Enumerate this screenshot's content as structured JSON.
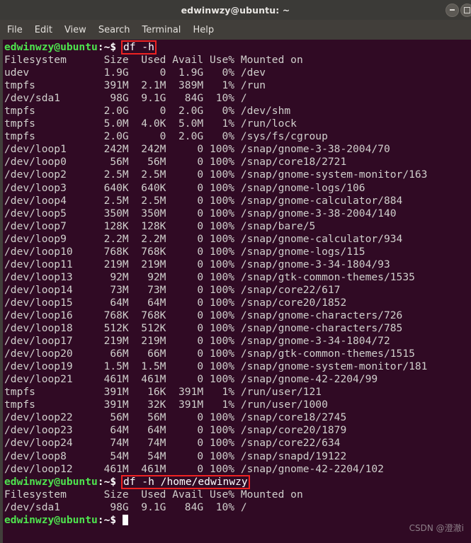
{
  "titlebar": {
    "title": "edwinwzy@ubuntu: ~",
    "minimize_label": "",
    "maximize_label": ""
  },
  "menubar": {
    "items": [
      {
        "label": "File"
      },
      {
        "label": "Edit"
      },
      {
        "label": "View"
      },
      {
        "label": "Search"
      },
      {
        "label": "Terminal"
      },
      {
        "label": "Help"
      }
    ]
  },
  "terminal": {
    "prompt_user": "edwinwzy@ubuntu",
    "prompt_path": ":~$ ",
    "command_1": "df -h",
    "command_2": "df -h /home/edwinwzy",
    "header": "Filesystem      Size  Used Avail Use% Mounted on",
    "rows_1": [
      "udev            1.9G     0  1.9G   0% /dev",
      "tmpfs           391M  2.1M  389M   1% /run",
      "/dev/sda1        98G  9.1G   84G  10% /",
      "tmpfs           2.0G     0  2.0G   0% /dev/shm",
      "tmpfs           5.0M  4.0K  5.0M   1% /run/lock",
      "tmpfs           2.0G     0  2.0G   0% /sys/fs/cgroup",
      "/dev/loop1      242M  242M     0 100% /snap/gnome-3-38-2004/70",
      "/dev/loop0       56M   56M     0 100% /snap/core18/2721",
      "/dev/loop2      2.5M  2.5M     0 100% /snap/gnome-system-monitor/163",
      "/dev/loop3      640K  640K     0 100% /snap/gnome-logs/106",
      "/dev/loop4      2.5M  2.5M     0 100% /snap/gnome-calculator/884",
      "/dev/loop5      350M  350M     0 100% /snap/gnome-3-38-2004/140",
      "/dev/loop7      128K  128K     0 100% /snap/bare/5",
      "/dev/loop9      2.2M  2.2M     0 100% /snap/gnome-calculator/934",
      "/dev/loop10     768K  768K     0 100% /snap/gnome-logs/115",
      "/dev/loop11     219M  219M     0 100% /snap/gnome-3-34-1804/93",
      "/dev/loop13      92M   92M     0 100% /snap/gtk-common-themes/1535",
      "/dev/loop14      73M   73M     0 100% /snap/core22/617",
      "/dev/loop15      64M   64M     0 100% /snap/core20/1852",
      "/dev/loop16     768K  768K     0 100% /snap/gnome-characters/726",
      "/dev/loop18     512K  512K     0 100% /snap/gnome-characters/785",
      "/dev/loop17     219M  219M     0 100% /snap/gnome-3-34-1804/72",
      "/dev/loop20      66M   66M     0 100% /snap/gtk-common-themes/1515",
      "/dev/loop19     1.5M  1.5M     0 100% /snap/gnome-system-monitor/181",
      "/dev/loop21     461M  461M     0 100% /snap/gnome-42-2204/99",
      "tmpfs           391M   16K  391M   1% /run/user/121",
      "tmpfs           391M   32K  391M   1% /run/user/1000",
      "/dev/loop22      56M   56M     0 100% /snap/core18/2745",
      "/dev/loop23      64M   64M     0 100% /snap/core20/1879",
      "/dev/loop24      74M   74M     0 100% /snap/core22/634",
      "/dev/loop8       54M   54M     0 100% /snap/snapd/19122",
      "/dev/loop12     461M  461M     0 100% /snap/gnome-42-2204/102"
    ],
    "rows_2": [
      "/dev/sda1        98G  9.1G   84G  10% /"
    ]
  },
  "watermark": {
    "text": "CSDN @澄澈i"
  },
  "colors": {
    "terminal_background": "#300a24",
    "titlebar_background": "#3b3a37",
    "menubar_background": "#413e3a",
    "prompt_green": "#4ee44e",
    "text": "#d0cfcc",
    "highlight_red": "#ee2222"
  }
}
